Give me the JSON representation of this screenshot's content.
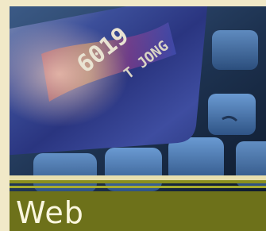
{
  "banner": {
    "title": "Web"
  },
  "image": {
    "subject": "credit-card-on-keyboard",
    "card_number_text": "6019",
    "cardholder_text": "T JONG"
  },
  "colors": {
    "page_background": "#f1e9c8",
    "banner_background": "#6d711a",
    "banner_text": "#fbf7df",
    "rule_olive": "#8a8f1e",
    "rule_cream": "#e8dfae"
  }
}
